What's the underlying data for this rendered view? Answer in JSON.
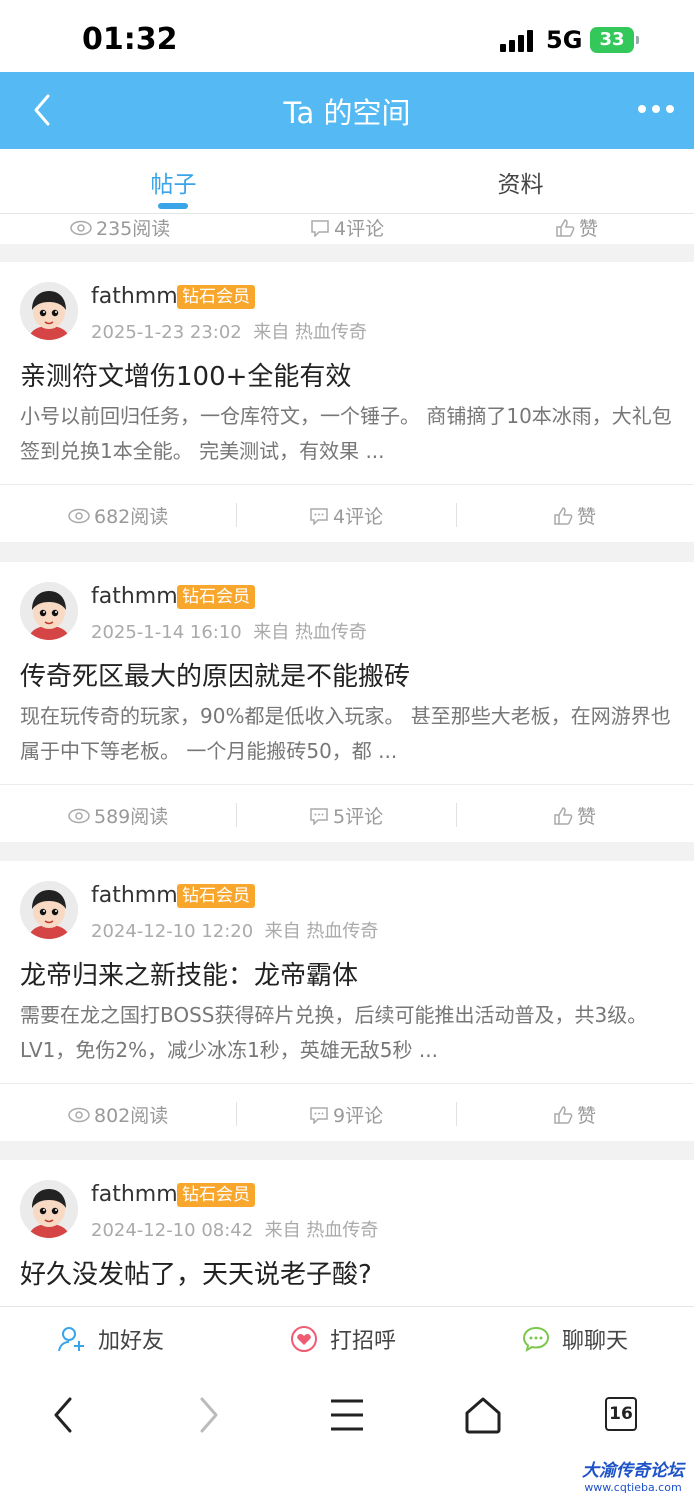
{
  "status": {
    "time": "01:32",
    "network": "5G",
    "battery": "33"
  },
  "navbar": {
    "title": "Ta 的空间"
  },
  "tabs": [
    {
      "label": "帖子"
    },
    {
      "label": "资料"
    }
  ],
  "partial_top": {
    "reads": "235阅读",
    "comments": "4评论",
    "likes": "赞"
  },
  "posts": [
    {
      "username": "fathmm",
      "badge": "钻石会员",
      "date": "2025-1-23 23:02",
      "source": "来自 热血传奇",
      "title": "亲测符文增伤100+全能有效",
      "excerpt": "小号以前回归任务，一仓库符文，一个锤子。 商铺摘了10本冰雨，大礼包签到兑换1本全能。 完美测试，有效果 ...",
      "reads": "682阅读",
      "comments": "4评论",
      "likes": "赞"
    },
    {
      "username": "fathmm",
      "badge": "钻石会员",
      "date": "2025-1-14 16:10",
      "source": "来自 热血传奇",
      "title": "传奇死区最大的原因就是不能搬砖",
      "excerpt": "现在玩传奇的玩家，90%都是低收入玩家。 甚至那些大老板，在网游界也属于中下等老板。 一个月能搬砖50，都 ...",
      "reads": "589阅读",
      "comments": "5评论",
      "likes": "赞"
    },
    {
      "username": "fathmm",
      "badge": "钻石会员",
      "date": "2024-12-10 12:20",
      "source": "来自 热血传奇",
      "title": "龙帝归来之新技能：龙帝霸体",
      "excerpt": "需要在龙之国打BOSS获得碎片兑换，后续可能推出活动普及，共3级。 LV1，免伤2%，减少冰冻1秒，英雄无敌5秒 ...",
      "reads": "802阅读",
      "comments": "9评论",
      "likes": "赞"
    },
    {
      "username": "fathmm",
      "badge": "钻石会员",
      "date": "2024-12-10 08:42",
      "source": "来自 热血传奇",
      "title": "好久没发帖了，天天说老子酸?",
      "excerpt": "",
      "reads": "",
      "comments": "",
      "likes": ""
    }
  ],
  "bottom_actions": [
    {
      "label": "加好友",
      "icon": "add-friend-icon",
      "color": "#3aa4e8"
    },
    {
      "label": "打招呼",
      "icon": "greet-heart-icon",
      "color": "#f05b72"
    },
    {
      "label": "聊聊天",
      "icon": "chat-icon",
      "color": "#7cc84e"
    }
  ],
  "browser": {
    "tab_count": "16"
  },
  "watermark": {
    "main": "大渝传奇论坛",
    "sub": "www.cqtieba.com"
  },
  "colors": {
    "accent": "#55baf3",
    "tab_active": "#3aa4e8",
    "badge": "#f8a72c"
  }
}
